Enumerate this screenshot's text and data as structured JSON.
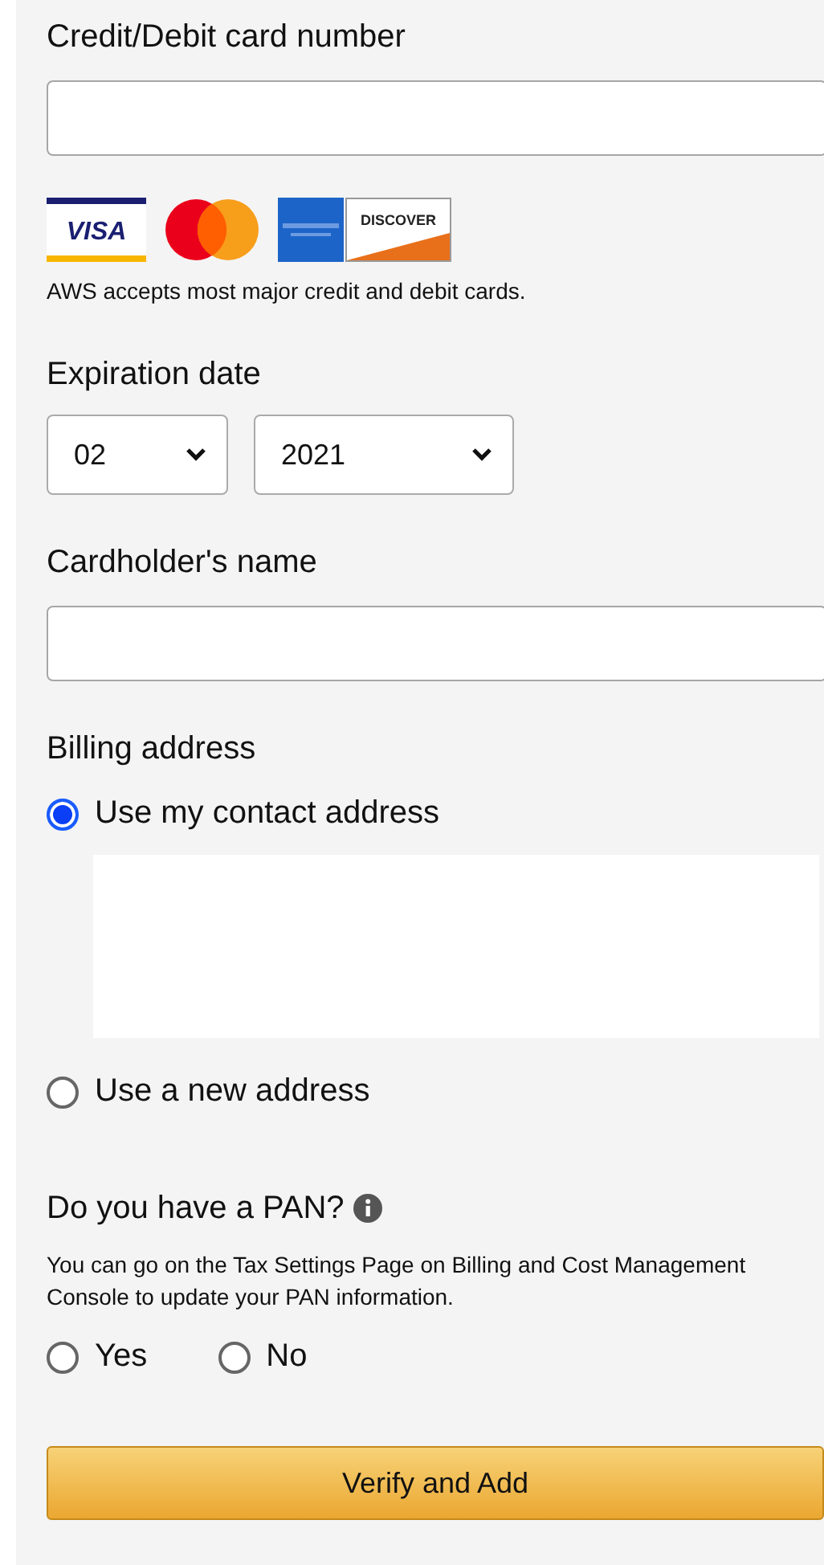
{
  "card_number": {
    "label": "Credit/Debit card number"
  },
  "card_logos": [
    {
      "kind": "visa",
      "label": "VISA"
    },
    {
      "kind": "mastercard"
    },
    {
      "kind": "amex"
    },
    {
      "kind": "discover",
      "label": "DISCOVER"
    }
  ],
  "card_note": "AWS accepts most major credit and debit cards.",
  "expiration": {
    "label": "Expiration date",
    "month": "02",
    "year": "2021"
  },
  "cardholder": {
    "label": "Cardholder's name"
  },
  "billing": {
    "label": "Billing address",
    "options": [
      {
        "label": "Use my contact address",
        "selected": true
      },
      {
        "label": "Use a new address",
        "selected": false
      }
    ]
  },
  "pan": {
    "label": "Do you have a PAN?",
    "info": "You can go on the Tax Settings Page on Billing and Cost Management Console to update your PAN information.",
    "options": [
      {
        "label": "Yes",
        "selected": false
      },
      {
        "label": "No",
        "selected": false
      }
    ]
  },
  "submit": "Verify and Add"
}
